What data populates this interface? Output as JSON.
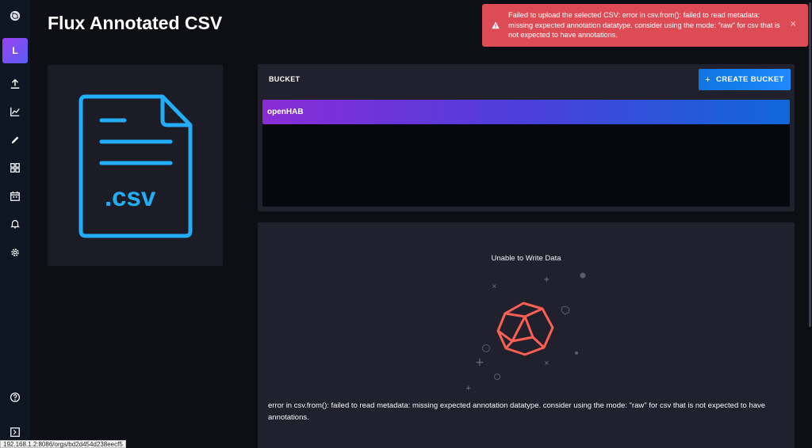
{
  "app": {
    "title": "Flux Annotated CSV"
  },
  "sidebar": {
    "org_initial": "L",
    "items": [
      {
        "icon": "influx-logo-icon"
      },
      {
        "icon": "upload-icon"
      },
      {
        "icon": "graph-icon"
      },
      {
        "icon": "pencil-icon"
      },
      {
        "icon": "dashboards-icon"
      },
      {
        "icon": "calendar-icon"
      },
      {
        "icon": "bell-icon"
      },
      {
        "icon": "gear-icon"
      },
      {
        "icon": "help-icon"
      },
      {
        "icon": "collapse-icon"
      }
    ]
  },
  "csv_panel": {
    "label": ".CSV",
    "accent": "#22adf6"
  },
  "bucket_panel": {
    "title": "BUCKET",
    "create_label": "CREATE BUCKET",
    "buckets": [
      {
        "name": "openHAB",
        "selected": true
      }
    ]
  },
  "error_panel": {
    "heading": "Unable to Write Data",
    "message": "error in csv.from(): failed to read metadata: missing expected annotation datatype. consider using the mode: \"raw\" for csv that is not expected to have annotations."
  },
  "toast": {
    "type": "error",
    "icon": "warning-icon",
    "message": "Failed to upload the selected CSV: error in csv.from(): failed to read metadata: missing expected annotation datatype. consider using the mode: \"raw\" for csv that is not expected to have annotations.",
    "color": "#dd4b55"
  },
  "statusbar": {
    "url": "192.168.1.2:8086/orgs/bd2d454d238eecf5"
  },
  "colors": {
    "background": "#0e0e15",
    "panel": "#21212d",
    "primary_button": "#1d8aff",
    "error_graphic": "#f95f53"
  }
}
